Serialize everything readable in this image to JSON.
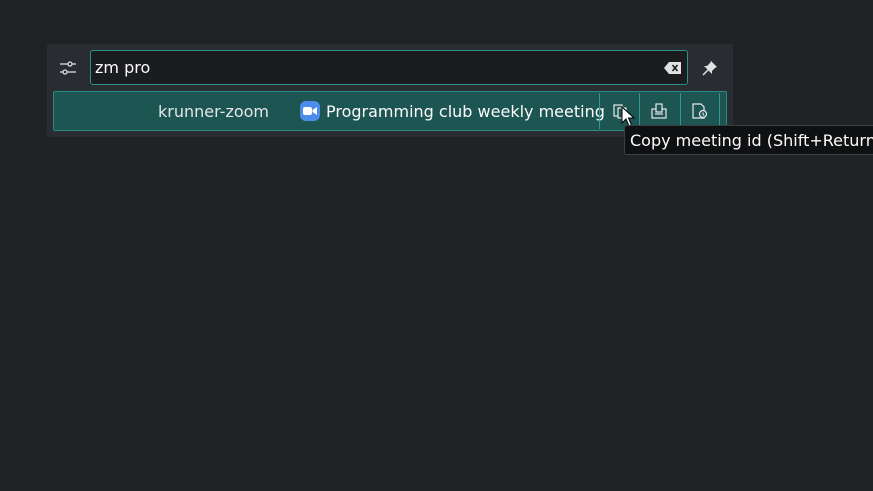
{
  "search": {
    "value": "zm pro"
  },
  "icons": {
    "config": "sliders-icon",
    "pin": "pin-icon",
    "clear": "clear-text-icon",
    "app": "zoom-video-icon"
  },
  "result": {
    "runner_name": "krunner-zoom",
    "title": "Programming club weekly meeting",
    "actions": [
      {
        "icon": "copy-icon"
      },
      {
        "icon": "copy-link-icon"
      },
      {
        "icon": "open-meeting-icon"
      }
    ]
  },
  "tooltip": {
    "text": "Copy meeting id (Shift+Return)"
  },
  "colors": {
    "background": "#202326",
    "panel": "#292c30",
    "accent": "#2f8f86",
    "result_bg": "#1d5552",
    "zoom_blue": "#4c8dec"
  }
}
